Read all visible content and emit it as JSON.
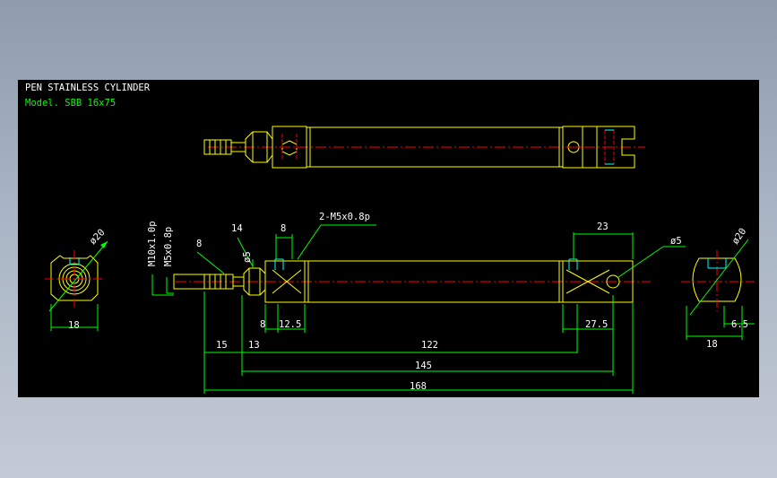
{
  "title": "PEN STAINLESS CYLINDER",
  "model": "Model. SBB 16x75",
  "colors": {
    "background": "#000000",
    "outline": "#ffff00",
    "dimension": "#00ff00",
    "centerline": "#ff0000",
    "hidden": "#00ffff",
    "text": "#ffffff"
  },
  "dimensions": {
    "end_left_dia": "ø20",
    "end_left_width": "18",
    "thread_m10": "M10x1.0p",
    "thread_m5": "M5x0.8p",
    "rod_len_8": "8",
    "hex_14": "14",
    "dia_5_rod": "ø5",
    "port_8_top": "8",
    "port_thread": "2-M5x0.8p",
    "rear_23": "23",
    "dia_5_pin": "ø5",
    "end_right_dia": "ø20",
    "bot_8": "8",
    "bot_12_5": "12.5",
    "bot_27_5": "27.5",
    "end_right_width": "18",
    "end_right_6_5": "6.5",
    "len_15": "15",
    "len_13": "13",
    "len_122": "122",
    "len_145": "145",
    "len_168": "168"
  }
}
